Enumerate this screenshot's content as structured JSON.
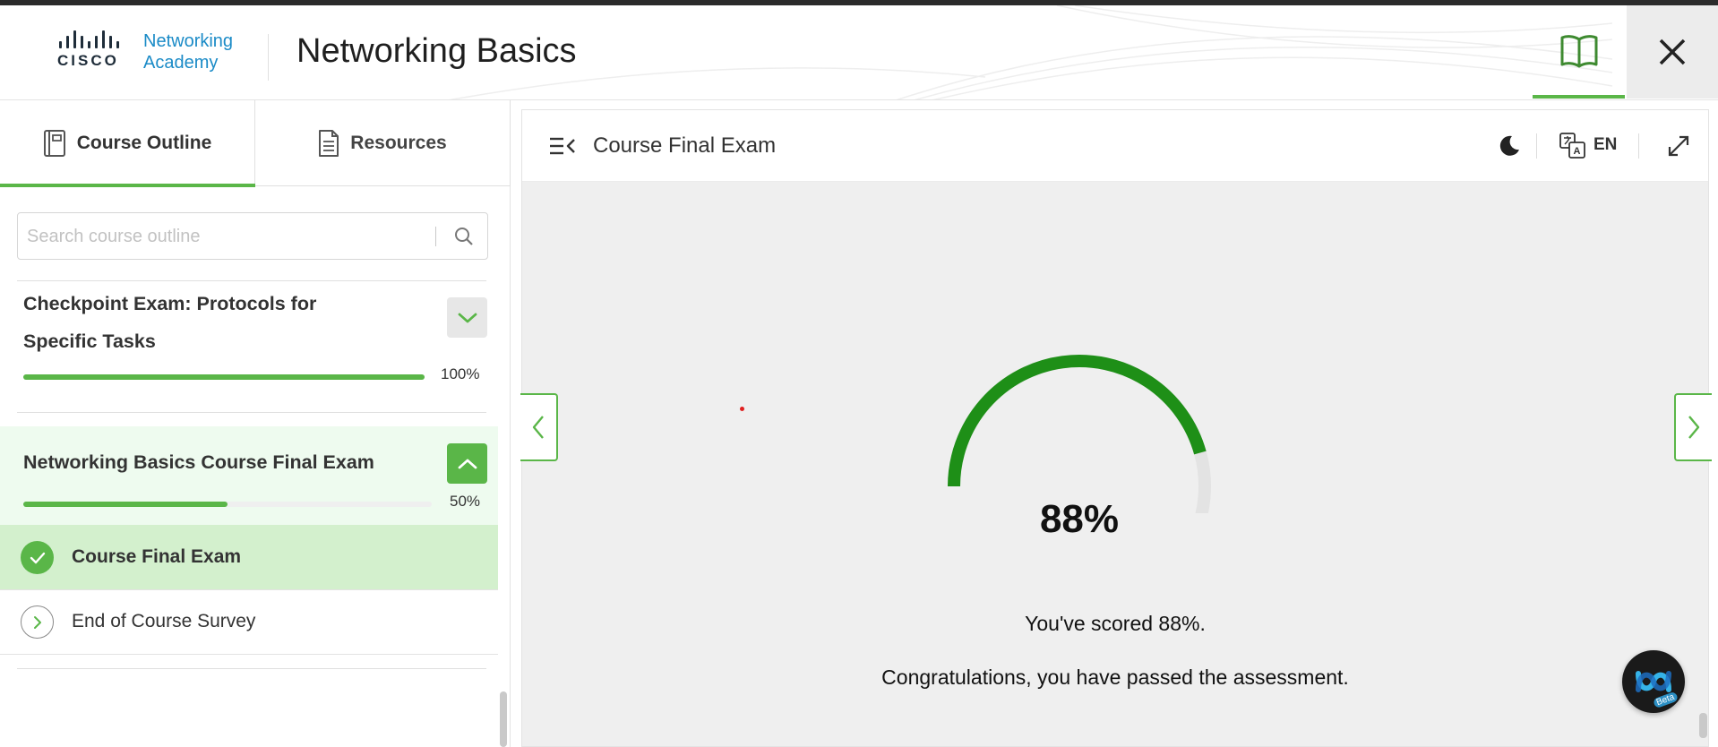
{
  "header": {
    "logo_word": "CISCO",
    "logo_line1": "Networking",
    "logo_line2": "Academy",
    "title": "Networking Basics"
  },
  "sidebar": {
    "tabs": [
      {
        "label": "Course Outline",
        "icon": "notebook-icon",
        "active": true
      },
      {
        "label": "Resources",
        "icon": "document-icon",
        "active": false
      }
    ],
    "search": {
      "placeholder": "Search course outline",
      "value": ""
    },
    "sections": [
      {
        "title_line1": "Checkpoint Exam: Protocols for",
        "title_line2": "Specific Tasks",
        "progress": 100,
        "progress_label": "100%",
        "expanded": false
      },
      {
        "title": "Networking Basics Course Final Exam",
        "progress": 50,
        "progress_label": "50%",
        "expanded": true
      }
    ],
    "items": [
      {
        "label": "Course Final Exam",
        "status": "completed",
        "icon": "check-icon"
      },
      {
        "label": "End of Course Survey",
        "status": "pending",
        "icon": "chevron-right-icon"
      }
    ]
  },
  "main": {
    "page_title": "Course Final Exam",
    "language": "EN",
    "score_value": 88,
    "score_label": "88%",
    "message_scored": "You've scored 88%.",
    "message_passed": "Congratulations, you have passed the assessment.",
    "fab_badge": "Beta"
  },
  "colors": {
    "accent_green": "#5ab648",
    "gauge_green": "#1e8f17",
    "brand_blue": "#1b8bc7"
  }
}
